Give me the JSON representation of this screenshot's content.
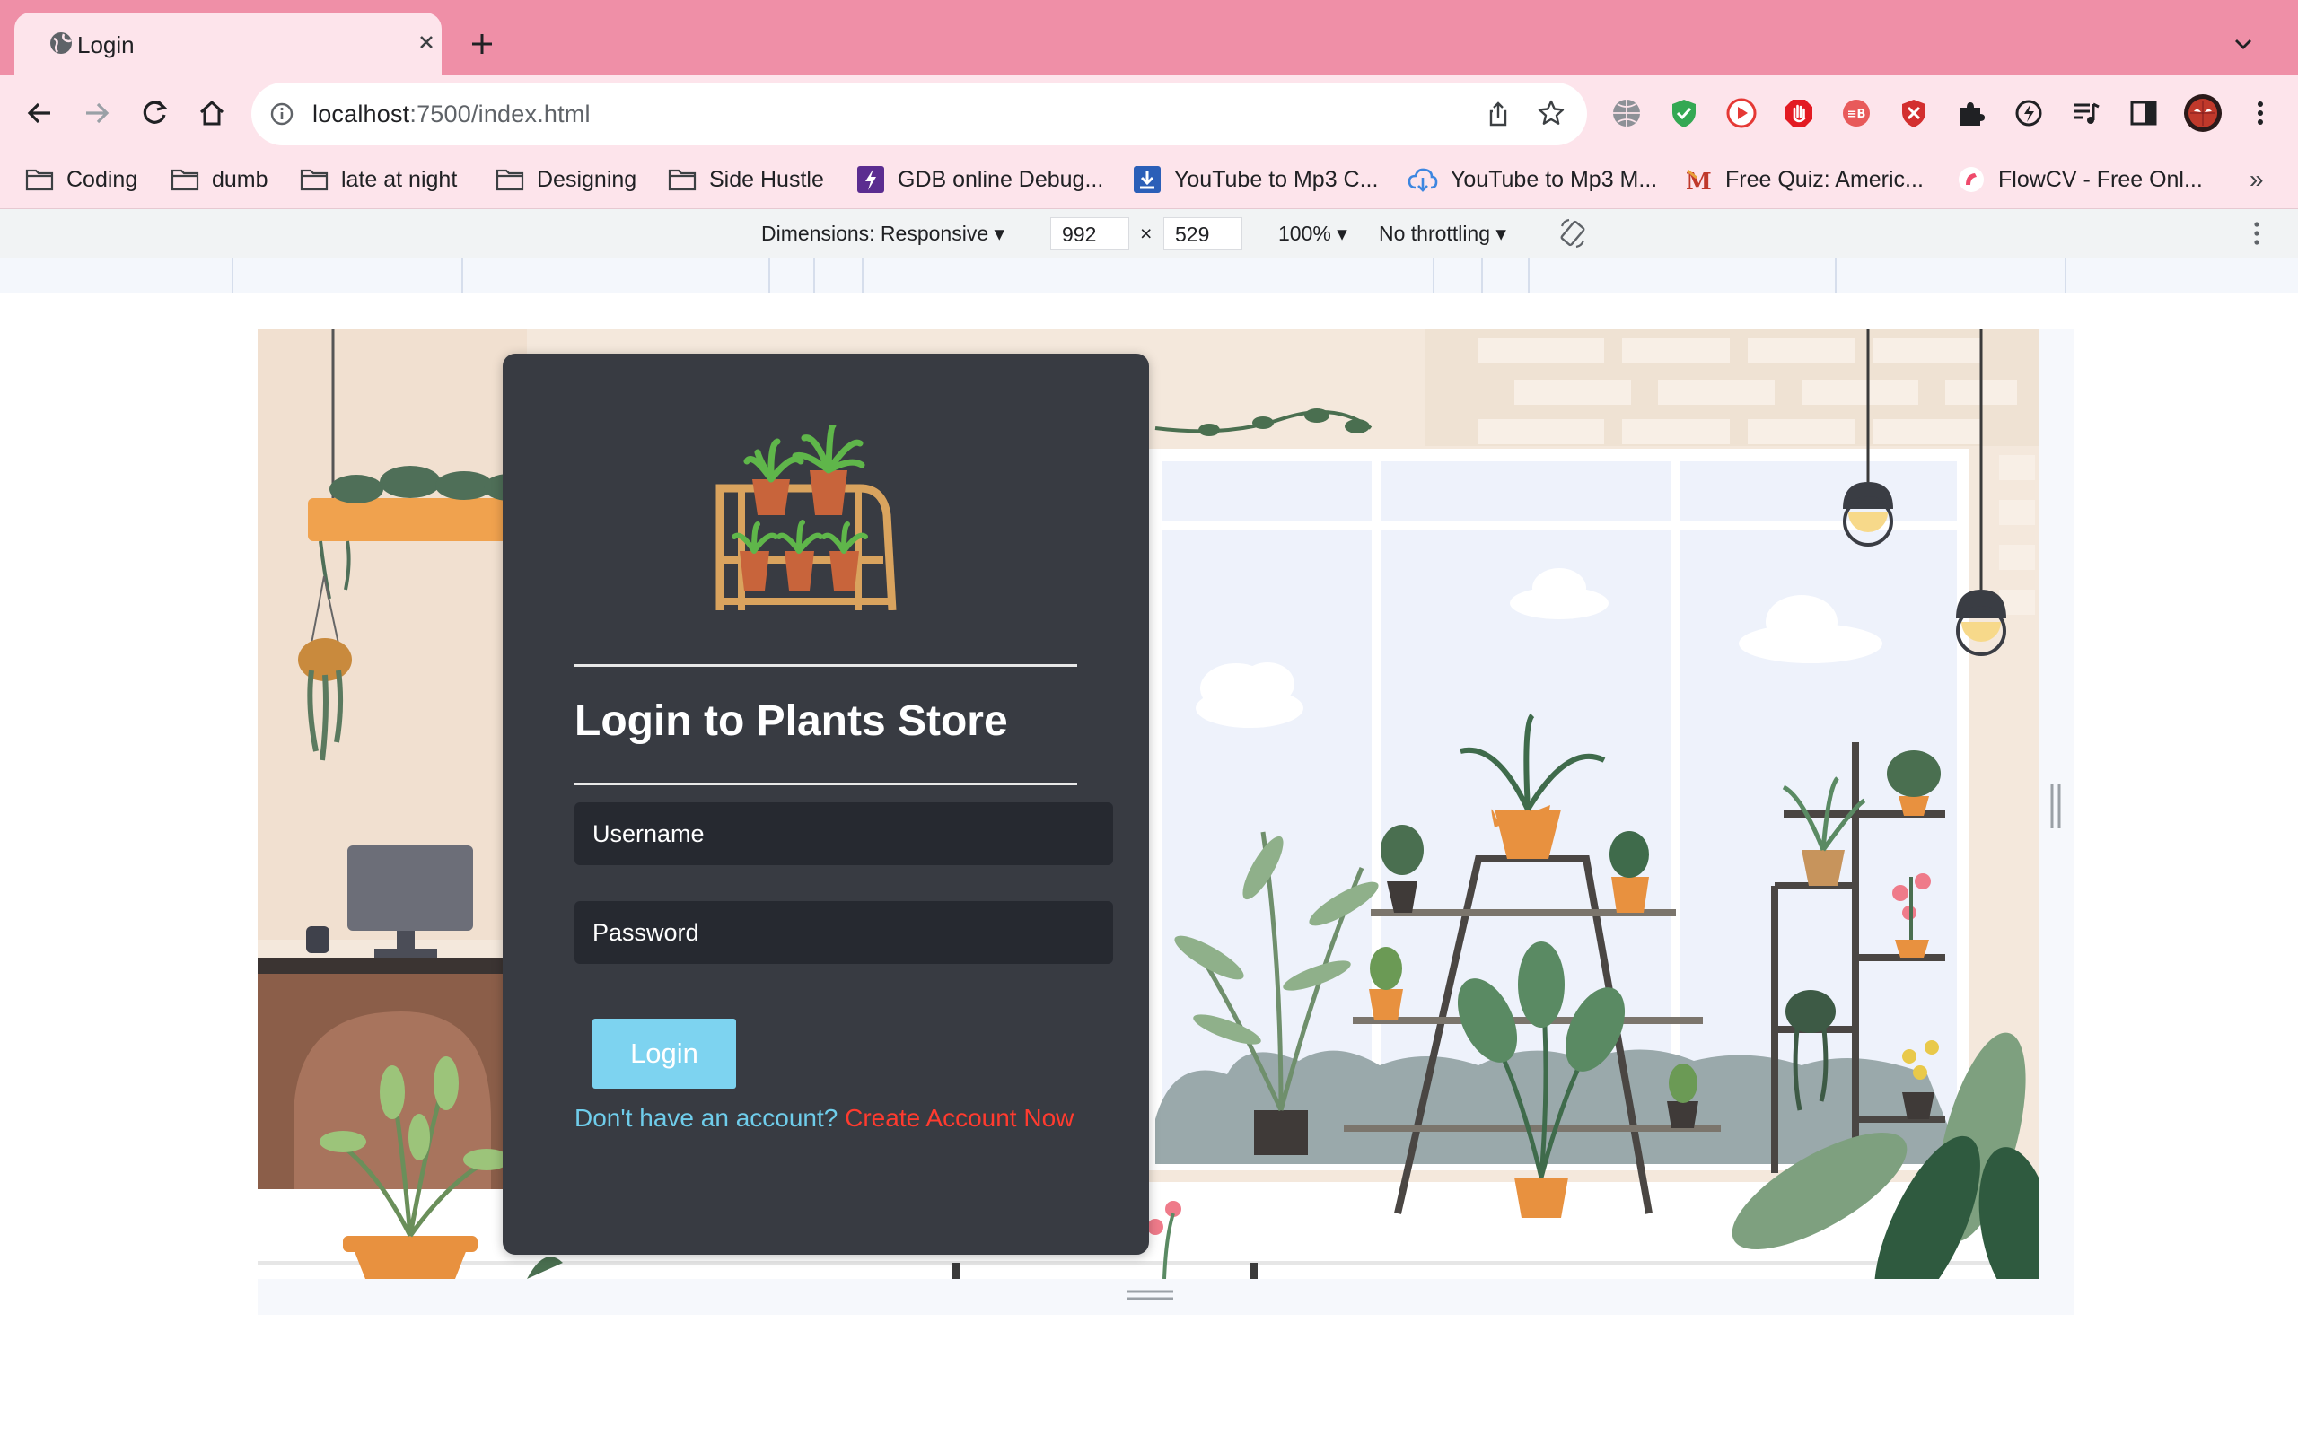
{
  "browser": {
    "tab": {
      "title": "Login"
    },
    "url": {
      "host": "localhost",
      "rest": ":7500/index.html"
    },
    "bookmarks": [
      {
        "label": "Coding",
        "icon": "folder-icon"
      },
      {
        "label": "dumb",
        "icon": "folder-icon"
      },
      {
        "label": "late at night",
        "icon": "folder-icon"
      },
      {
        "label": "Designing",
        "icon": "folder-icon"
      },
      {
        "label": "Side Hustle",
        "icon": "folder-icon"
      },
      {
        "label": "GDB online Debug...",
        "icon": "gdb-icon"
      },
      {
        "label": "YouTube to Mp3 C...",
        "icon": "download-icon"
      },
      {
        "label": "YouTube to Mp3 M...",
        "icon": "cloud-download-icon"
      },
      {
        "label": "Free Quiz: Americ...",
        "icon": "quiz-icon"
      },
      {
        "label": "FlowCV - Free Onl...",
        "icon": "flowcv-icon"
      }
    ],
    "bookmarks_more": "»"
  },
  "devtools": {
    "dimensions_label": "Dimensions: Responsive",
    "width": "992",
    "times": "×",
    "height": "529",
    "zoom": "100%",
    "throttling": "No throttling"
  },
  "login": {
    "title": "Login to Plants Store",
    "username_placeholder": "Username",
    "password_placeholder": "Password",
    "button_label": "Login",
    "signup_question": "Don't have an account?",
    "signup_link": "Create Account Now"
  },
  "colors": {
    "tabbar": "#ef8fa7",
    "toolbar": "#fde4eb",
    "card": "#383b42",
    "button": "#7dd3f0",
    "link": "#ff3b2f",
    "question": "#6fcdeb"
  }
}
